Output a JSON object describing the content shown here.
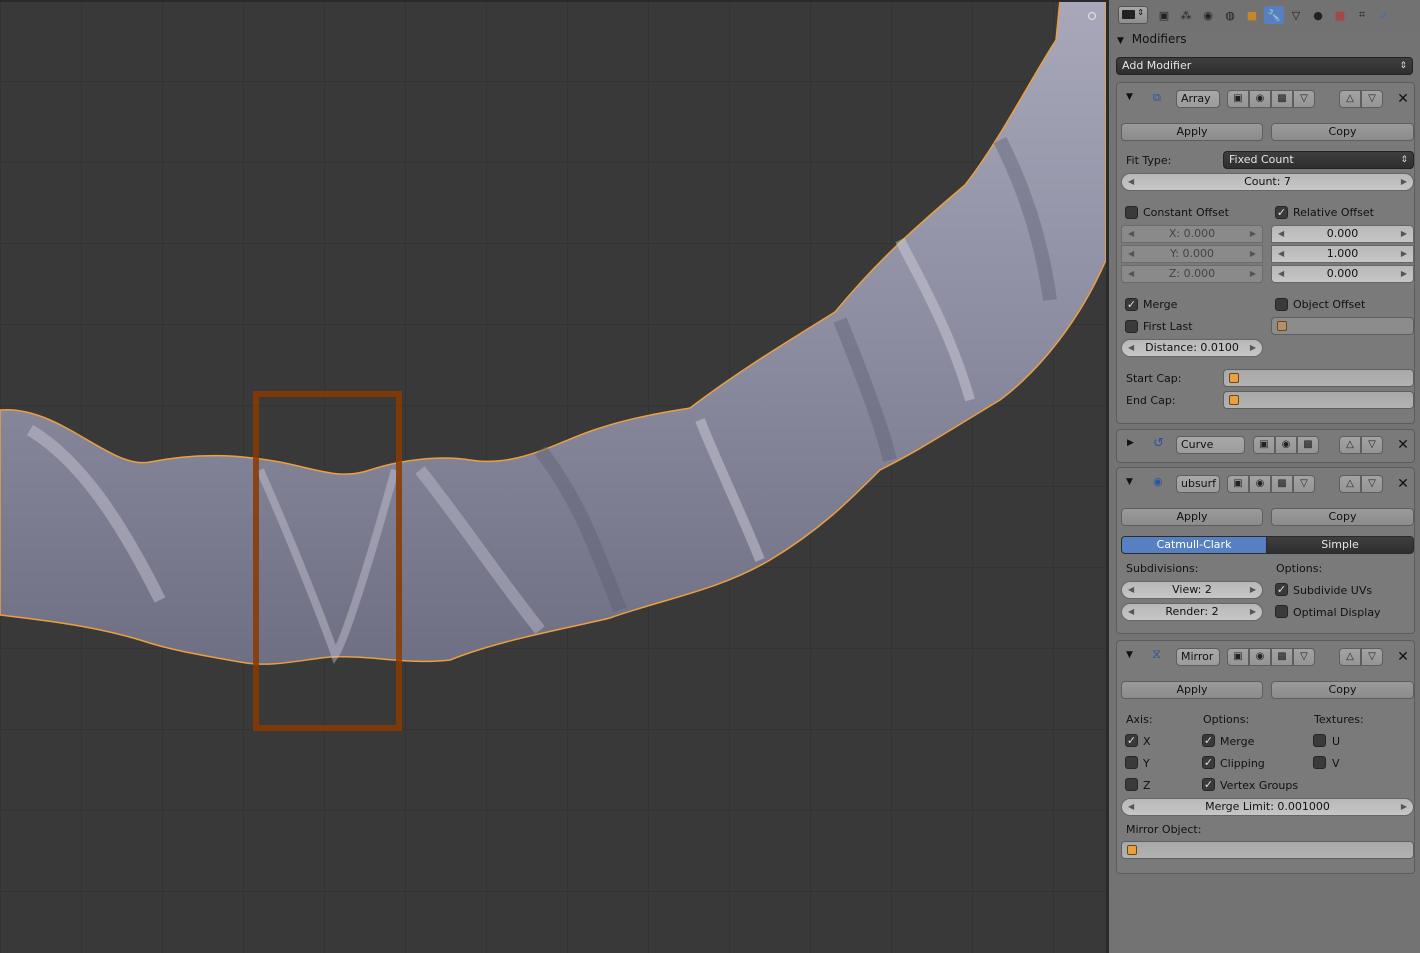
{
  "panel": {
    "section_title": "Modifiers",
    "add_modifier_label": "Add Modifier",
    "array": {
      "name": "Array",
      "apply_label": "Apply",
      "copy_label": "Copy",
      "fit_type_label": "Fit Type:",
      "fit_type_value": "Fixed Count",
      "count": "Count: 7",
      "constant_offset_label": "Constant Offset",
      "constant_offset_checked": false,
      "relative_offset_label": "Relative Offset",
      "relative_offset_checked": true,
      "const_x": "X: 0.000",
      "const_y": "Y: 0.000",
      "const_z": "Z: 0.000",
      "rel_x": "0.000",
      "rel_y": "1.000",
      "rel_z": "0.000",
      "merge_label": "Merge",
      "merge_checked": true,
      "object_offset_label": "Object Offset",
      "object_offset_checked": false,
      "first_last_label": "First Last",
      "first_last_checked": false,
      "distance": "Distance: 0.0100",
      "start_cap_label": "Start Cap:",
      "end_cap_label": "End Cap:"
    },
    "curve": {
      "name": "Curve"
    },
    "subsurf": {
      "name": "ubsurf",
      "apply_label": "Apply",
      "copy_label": "Copy",
      "mode_catmull": "Catmull-Clark",
      "mode_simple": "Simple",
      "subdivisions_label": "Subdivisions:",
      "options_label": "Options:",
      "view": "View: 2",
      "render": "Render: 2",
      "subdivide_uvs_label": "Subdivide UVs",
      "subdivide_uvs_checked": true,
      "optimal_display_label": "Optimal Display",
      "optimal_display_checked": false
    },
    "mirror": {
      "name": "Mirror",
      "apply_label": "Apply",
      "copy_label": "Copy",
      "axis_label": "Axis:",
      "options_label": "Options:",
      "textures_label": "Textures:",
      "x_label": "X",
      "x_checked": true,
      "y_label": "Y",
      "y_checked": false,
      "z_label": "Z",
      "z_checked": false,
      "merge_label": "Merge",
      "merge_checked": true,
      "clipping_label": "Clipping",
      "clipping_checked": true,
      "vertex_groups_label": "Vertex Groups",
      "vertex_groups_checked": true,
      "u_label": "U",
      "u_checked": false,
      "v_label": "V",
      "v_checked": false,
      "merge_limit": "Merge Limit: 0.001000",
      "mirror_object_label": "Mirror Object:"
    }
  },
  "colors": {
    "active_tab": "#5680c2",
    "selection_outline": "#e8a040",
    "highlight_box": "#8a3a00"
  }
}
